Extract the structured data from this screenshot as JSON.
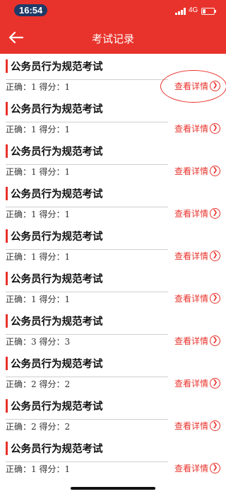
{
  "status_bar": {
    "time": "16:54",
    "network": "4G"
  },
  "nav": {
    "title": "考试记录"
  },
  "records": [
    {
      "title": "公务员行为规范考试",
      "score": "正确：1 得分：1",
      "detail": "查看详情"
    },
    {
      "title": "公务员行为规范考试",
      "score": "正确：1 得分：1",
      "detail": "查看详情"
    },
    {
      "title": "公务员行为规范考试",
      "score": "正确：1 得分：1",
      "detail": "查看详情"
    },
    {
      "title": "公务员行为规范考试",
      "score": "正确：1 得分：1",
      "detail": "查看详情"
    },
    {
      "title": "公务员行为规范考试",
      "score": "正确：1 得分：1",
      "detail": "查看详情"
    },
    {
      "title": "公务员行为规范考试",
      "score": "正确：1 得分：1",
      "detail": "查看详情"
    },
    {
      "title": "公务员行为规范考试",
      "score": "正确：3 得分：3",
      "detail": "查看详情"
    },
    {
      "title": "公务员行为规范考试",
      "score": "正确：2 得分：2",
      "detail": "查看详情"
    },
    {
      "title": "公务员行为规范考试",
      "score": "正确：2 得分：2",
      "detail": "查看详情"
    },
    {
      "title": "公务员行为规范考试",
      "score": "正确：1 得分：1",
      "detail": "查看详情"
    }
  ],
  "colors": {
    "accent": "#e8332c",
    "time_pill": "#1f3a66"
  },
  "icons": {
    "back": "arrow-left-icon",
    "detail": "chevron-right-circle-icon"
  }
}
